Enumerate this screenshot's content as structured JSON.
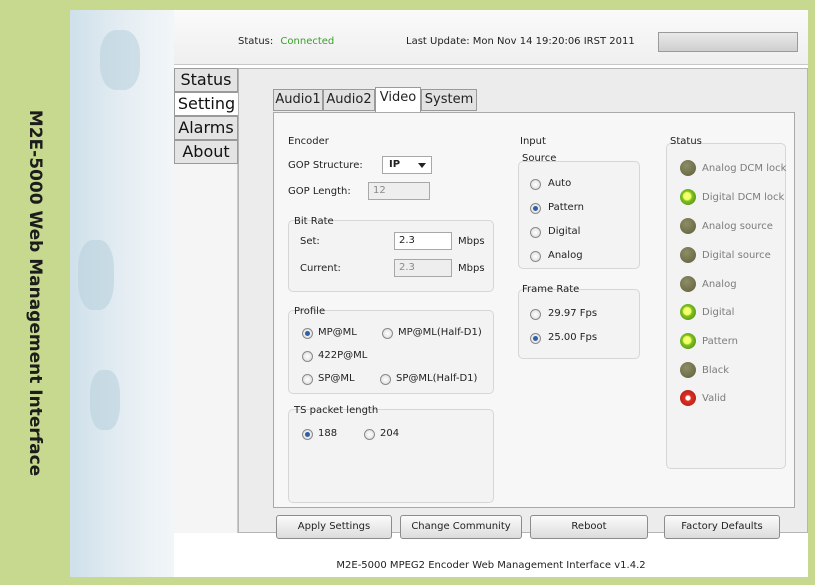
{
  "banner": {
    "text": "M2E-5000 Web Management Interface"
  },
  "header": {
    "status_label": "Status:",
    "status_value": "Connected",
    "last_update": "Last Update: Mon Nov 14 19:20:06 IRST 2011",
    "status_color": "#3aa02c"
  },
  "menu": {
    "items": [
      "Status",
      "Setting",
      "Alarms",
      "About"
    ],
    "active": "Setting"
  },
  "tabs": {
    "items": [
      "Audio1",
      "Audio2",
      "Video",
      "System"
    ],
    "active": "Video"
  },
  "encoder": {
    "title": "Encoder",
    "gop_structure_label": "GOP Structure:",
    "gop_structure_value": "IP",
    "gop_length_label": "GOP Length:",
    "gop_length_value": "12"
  },
  "bitrate": {
    "title": "Bit Rate",
    "set_label": "Set:",
    "set_value": "2.3",
    "current_label": "Current:",
    "current_value": "2.3",
    "unit": "Mbps"
  },
  "profile": {
    "title": "Profile",
    "options": [
      "MP@ML",
      "MP@ML(Half-D1)",
      "422P@ML",
      "SP@ML",
      "SP@ML(Half-D1)"
    ],
    "selected": "MP@ML"
  },
  "ts": {
    "title": "TS packet length",
    "options": [
      "188",
      "204"
    ],
    "selected": "188"
  },
  "input": {
    "title": "Input",
    "source_title": "Source",
    "source_options": [
      "Auto",
      "Pattern",
      "Digital",
      "Analog"
    ],
    "source_selected": "Pattern",
    "framerate_title": "Frame Rate",
    "framerate_options": [
      "29.97 Fps",
      "25.00 Fps"
    ],
    "framerate_selected": "25.00 Fps"
  },
  "status_panel": {
    "title": "Status",
    "items": [
      {
        "label": "Analog DCM lock",
        "state": "off"
      },
      {
        "label": "Digital DCM lock",
        "state": "green"
      },
      {
        "label": "Analog source",
        "state": "off"
      },
      {
        "label": "Digital source",
        "state": "off"
      },
      {
        "label": "Analog",
        "state": "off"
      },
      {
        "label": "Digital",
        "state": "green"
      },
      {
        "label": "Pattern",
        "state": "green"
      },
      {
        "label": "Black",
        "state": "off"
      },
      {
        "label": "Valid",
        "state": "red"
      }
    ]
  },
  "buttons": {
    "apply": "Apply Settings",
    "community": "Change Community",
    "reboot": "Reboot",
    "defaults": "Factory Defaults"
  },
  "footer": {
    "text": "M2E-5000 MPEG2 Encoder Web Management Interface  v1.4.2"
  }
}
